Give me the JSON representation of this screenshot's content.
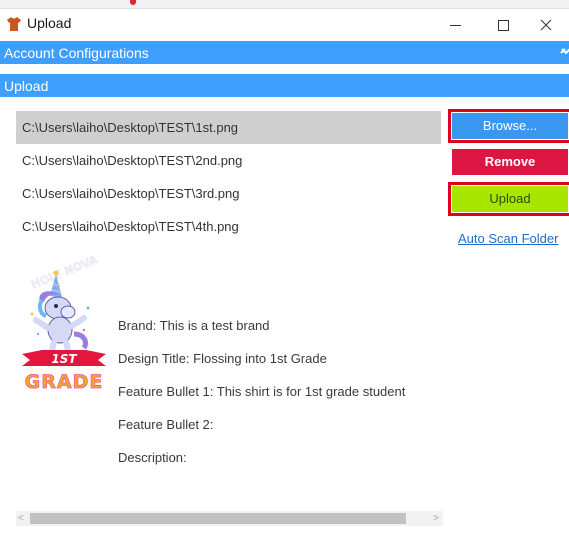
{
  "window": {
    "title": "Upload",
    "minimize_symbol": "—",
    "maximize_symbol": "☐",
    "close_symbol": "✕"
  },
  "sections": {
    "account": {
      "label": "Account Configurations",
      "expand_icon": "chevron-down-icon"
    },
    "upload": {
      "label": "Upload"
    }
  },
  "files": [
    "C:\\Users\\laiho\\Desktop\\TEST\\1st.png",
    "C:\\Users\\laiho\\Desktop\\TEST\\2nd.png",
    "C:\\Users\\laiho\\Desktop\\TEST\\3rd.png",
    "C:\\Users\\laiho\\Desktop\\TEST\\4th.png"
  ],
  "selected_file_index": 0,
  "buttons": {
    "browse": "Browse...",
    "remove": "Remove",
    "upload": "Upload",
    "auto_scan": "Auto Scan Folder"
  },
  "preview": {
    "top_text": "HOLY NOVA",
    "badge_text": "1ST",
    "grade_text": "GRADE"
  },
  "details": {
    "brand": "Brand: This is a test brand",
    "design_title": "Design Title: Flossing into 1st Grade",
    "feature_bullet_1": "Feature Bullet 1: This shirt is for 1st grade student",
    "feature_bullet_2": "Feature Bullet 2:",
    "description": "Description:"
  },
  "colors": {
    "section_header": "#3f9fff",
    "browse": "#3a97f0",
    "remove": "#dc1643",
    "upload": "#a8e600",
    "highlight_outline": "#e0001b",
    "link": "#1c6fc7"
  }
}
